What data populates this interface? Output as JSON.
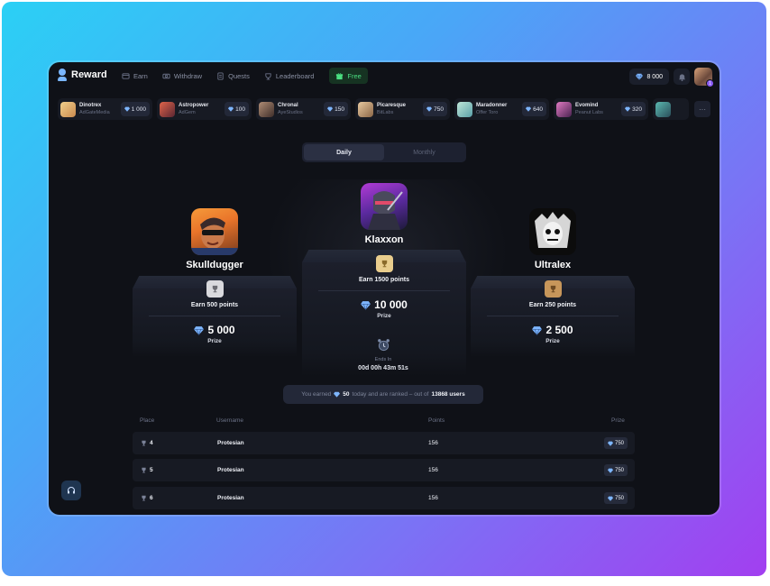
{
  "app": {
    "title": "Reward"
  },
  "nav": [
    {
      "label": "Earn",
      "icon": "earn-icon"
    },
    {
      "label": "Withdraw",
      "icon": "withdraw-icon"
    },
    {
      "label": "Quests",
      "icon": "quests-icon"
    },
    {
      "label": "Leaderboard",
      "icon": "leaderboard-icon"
    },
    {
      "label": "Free",
      "icon": "gift-icon"
    }
  ],
  "header": {
    "balance": "8 000",
    "avatar_badge": "1"
  },
  "offers": [
    {
      "name": "Dinotrex",
      "company": "AdGateMedia",
      "points": "1 000",
      "color": "#e2b46a"
    },
    {
      "name": "Astropower",
      "company": "AdGem",
      "points": "100",
      "color": "#c24a3a"
    },
    {
      "name": "Chronal",
      "company": "AyeStudios",
      "points": "150",
      "color": "#8a6a55"
    },
    {
      "name": "Picaresque",
      "company": "BitLabs",
      "points": "750",
      "color": "#c7a37a"
    },
    {
      "name": "Maradonner",
      "company": "Offer Toro",
      "points": "640",
      "color": "#7fc6b8"
    },
    {
      "name": "Evomind",
      "company": "Peanut Labs",
      "points": "320",
      "color": "#b5488e"
    },
    {
      "name": "",
      "company": "",
      "points": "",
      "color": "#3f8a8a"
    }
  ],
  "more_label": "···",
  "tabs": {
    "daily": "Daily",
    "monthly": "Monthly",
    "active": "daily"
  },
  "podium": {
    "first": {
      "name": "Klaxxon",
      "earn": "Earn 1500 points",
      "prize": "10 000",
      "prize_label": "Prize",
      "trophy_color": "#e9cd8d"
    },
    "second": {
      "name": "Skulldugger",
      "earn": "Earn 500 points",
      "prize": "5 000",
      "prize_label": "Prize",
      "trophy_color": "#d9d9dd"
    },
    "third": {
      "name": "Ultralex",
      "earn": "Earn 250 points",
      "prize": "2 500",
      "prize_label": "Prize",
      "trophy_color": "#c7965a"
    }
  },
  "timer": {
    "label": "Ends In",
    "value": "00d 00h 43m 51s"
  },
  "summary": {
    "prefix": "You earned",
    "amount": "50",
    "middle": "today and are ranked – out of",
    "total": "13868 users"
  },
  "table": {
    "headers": {
      "place": "Place",
      "username": "Username",
      "points": "Points",
      "prize": "Prize"
    },
    "rows": [
      {
        "place": "4",
        "username": "Protesian",
        "points": "156",
        "prize": "750"
      },
      {
        "place": "5",
        "username": "Protesian",
        "points": "156",
        "prize": "750"
      },
      {
        "place": "6",
        "username": "Protesian",
        "points": "156",
        "prize": "750"
      }
    ]
  },
  "colors": {
    "accent": "#7ab6ff",
    "free": "#4ade80",
    "gem": "#7eb6ff"
  }
}
